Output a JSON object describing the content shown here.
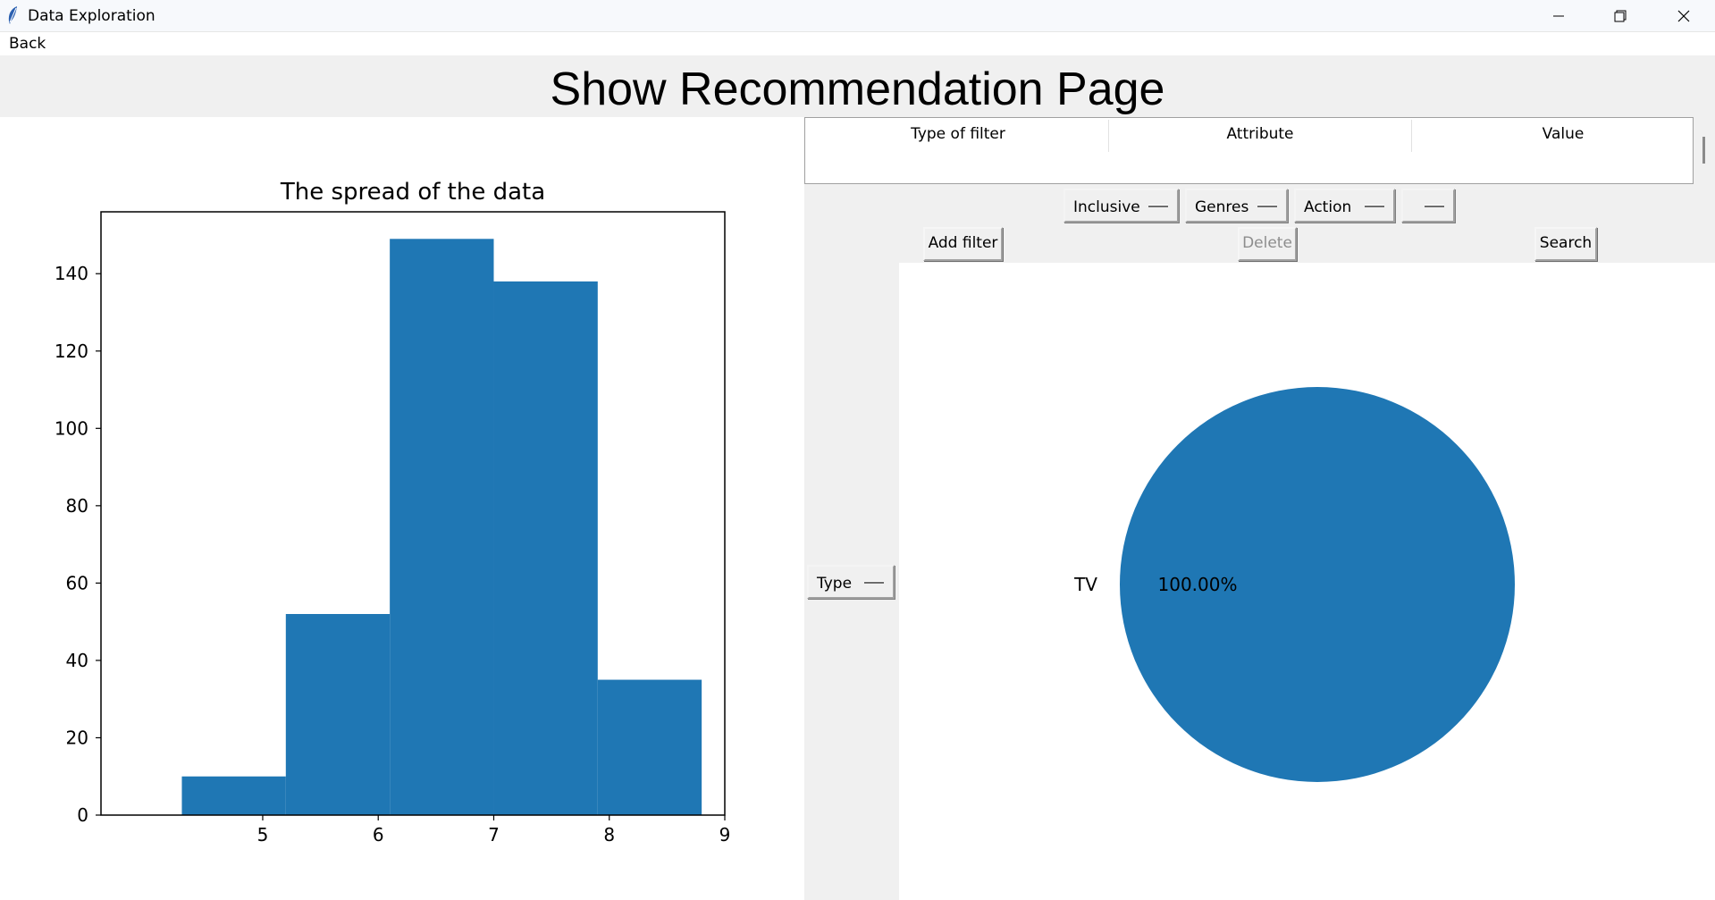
{
  "window": {
    "title": "Data Exploration"
  },
  "menu": {
    "back_label": "Back"
  },
  "header": {
    "title": "Show Recommendation Page"
  },
  "filter_table": {
    "columns": [
      "Type of filter",
      "Attribute",
      "Value"
    ],
    "rows": []
  },
  "filter_controls": {
    "type_selected": "Inclusive",
    "attribute_selected": "Genres",
    "value_selected": "Action",
    "extra_selected": "",
    "add_label": "Add filter",
    "delete_label": "Delete",
    "search_label": "Search"
  },
  "pie_selector": {
    "selected": "Type"
  },
  "colors": {
    "series": "#1f77b4",
    "background": "#f0f0f0"
  },
  "chart_data": [
    {
      "type": "bar",
      "title": "The spread of the data",
      "bin_edges": [
        4.3,
        5.2,
        6.1,
        7.0,
        7.9,
        8.8
      ],
      "values": [
        10,
        52,
        149,
        138,
        35
      ],
      "xlim": [
        3.6,
        9.0
      ],
      "ylim": [
        0,
        156
      ],
      "xticks": [
        5,
        6,
        7,
        8,
        9
      ],
      "yticks": [
        0,
        20,
        40,
        60,
        80,
        100,
        120,
        140
      ],
      "grid": false
    },
    {
      "type": "pie",
      "labels": [
        "TV"
      ],
      "values": [
        100.0
      ],
      "autopct": [
        "100.00%"
      ]
    }
  ]
}
